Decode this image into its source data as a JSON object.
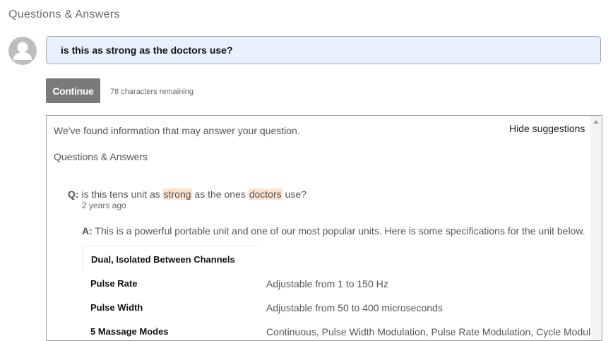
{
  "qa": {
    "title": "Questions & Answers"
  },
  "question_form": {
    "input_value": "is this as strong as the doctors use?",
    "continue_label": "Continue",
    "chars_remaining": "78 characters remaining"
  },
  "suggestions": {
    "found_text": "We've found information that may answer your question.",
    "hide_label": "Hide suggestions",
    "section_title": "Questions & Answers",
    "item": {
      "q_label": "Q:",
      "q_parts": [
        "is this tens unit as ",
        "strong",
        " as the ones ",
        "doctors",
        " use?"
      ],
      "date": "2 years ago",
      "a_label": "A:",
      "answer": "This is a powerful portable unit and one of our most popular units. Here is some specifications for the unit below.",
      "specs": [
        {
          "name": "Dual, Isolated Between Channels",
          "value": ""
        },
        {
          "name": "Pulse Rate",
          "value": "Adjustable from 1 to 150 Hz"
        },
        {
          "name": "Pulse Width",
          "value": "Adjustable from 50 to 400 microseconds"
        },
        {
          "name": "5 Massage Modes",
          "value": "Continuous, Pulse Width Modulation, Pulse Rate Modulation, Cycle Modulation"
        }
      ]
    }
  },
  "colors": {
    "highlight": "#fbe3cc",
    "input_bg": "#e8f0fc",
    "button_bg": "#7a7a7a"
  },
  "icons": {
    "avatar": "user-avatar-icon",
    "scroll_up": "scroll-up-arrow-icon"
  }
}
